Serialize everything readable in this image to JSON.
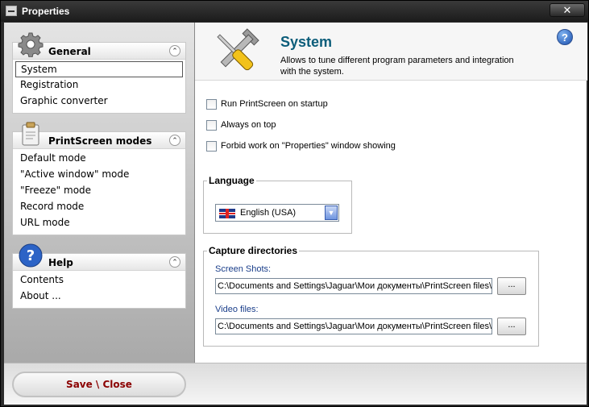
{
  "window": {
    "title": "Properties",
    "close_glyph": "✕"
  },
  "sidebar": {
    "groups": [
      {
        "title": "General",
        "icon": "gear-icon",
        "items": [
          "System",
          "Registration",
          "Graphic converter"
        ],
        "selected": "System"
      },
      {
        "title": "PrintScreen modes",
        "icon": "clipboard-icon",
        "items": [
          "Default mode",
          "\"Active window\" mode",
          "\"Freeze\" mode",
          "Record mode",
          "URL mode"
        ]
      },
      {
        "title": "Help",
        "icon": "help-icon",
        "items": [
          "Contents",
          "About ..."
        ]
      }
    ],
    "collapse_glyph": "⌃"
  },
  "header": {
    "title": "System",
    "description": "Allows to tune different program parameters and integration with the system.",
    "help_glyph": "?"
  },
  "options": [
    {
      "label": "Run PrintScreen on startup",
      "checked": false
    },
    {
      "label": "Always on top",
      "checked": false
    },
    {
      "label": "Forbid work on \"Properties\" window showing",
      "checked": false
    }
  ],
  "language": {
    "legend": "Language",
    "selected": "English (USA)"
  },
  "capture": {
    "legend": "Capture directories",
    "screenshots_label": "Screen Shots:",
    "screenshots_path": "C:\\Documents and Settings\\Jaguar\\Мои документы\\PrintScreen files\\",
    "video_label": "Video files:",
    "video_path": "C:\\Documents and Settings\\Jaguar\\Мои документы\\PrintScreen files\\",
    "browse_label": "..."
  },
  "footer": {
    "save_label": "Save \\ Close"
  },
  "colors": {
    "title_blue": "#0c5d7a",
    "save_red": "#8b0000"
  }
}
